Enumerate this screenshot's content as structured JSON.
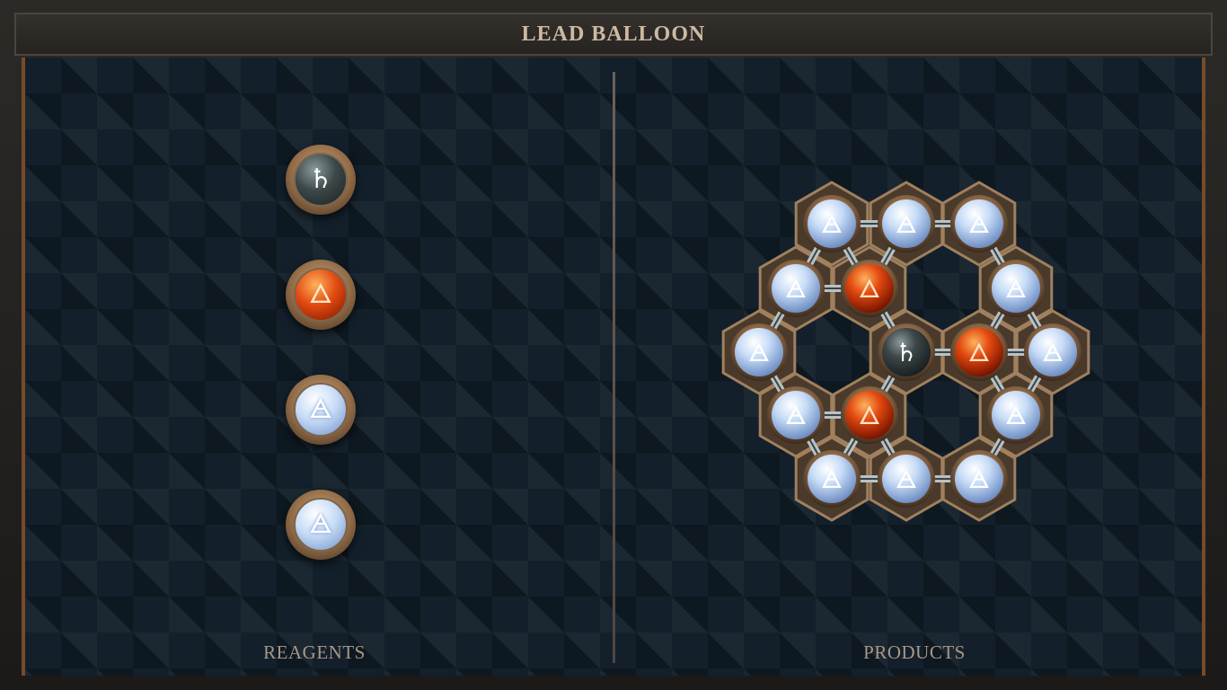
{
  "title": "LEAD BALLOON",
  "panels": {
    "reagents_label": "REAGENTS",
    "products_label": "PRODUCTS"
  },
  "reagents": [
    {
      "element": "lead",
      "symbol": "♄"
    },
    {
      "element": "fire",
      "symbol": "🜂"
    },
    {
      "element": "air",
      "symbol": "🜁"
    },
    {
      "element": "air",
      "symbol": "🜁"
    }
  ],
  "product_molecule": {
    "atoms": [
      {
        "id": "a1",
        "element": "air",
        "symbol": "🜁"
      },
      {
        "id": "a2",
        "element": "air",
        "symbol": "🜁"
      },
      {
        "id": "a3",
        "element": "air",
        "symbol": "🜁"
      },
      {
        "id": "a4",
        "element": "air",
        "symbol": "🜁"
      },
      {
        "id": "f1",
        "element": "fire",
        "symbol": "🜂"
      },
      {
        "id": "a5",
        "element": "air",
        "symbol": "🜁"
      },
      {
        "id": "a6",
        "element": "air",
        "symbol": "🜁"
      },
      {
        "id": "pb",
        "element": "lead",
        "symbol": "♄"
      },
      {
        "id": "f2",
        "element": "fire",
        "symbol": "🜂"
      },
      {
        "id": "a7",
        "element": "air",
        "symbol": "🜁"
      },
      {
        "id": "a8",
        "element": "air",
        "symbol": "🜁"
      },
      {
        "id": "f3",
        "element": "fire",
        "symbol": "🜂"
      },
      {
        "id": "a9",
        "element": "air",
        "symbol": "🜁"
      },
      {
        "id": "a10",
        "element": "air",
        "symbol": "🜁"
      },
      {
        "id": "a11",
        "element": "air",
        "symbol": "🜁"
      },
      {
        "id": "a12",
        "element": "air",
        "symbol": "🜁"
      }
    ]
  },
  "colors": {
    "board_bg": "#13202b",
    "accent_copper": "#7a4a28",
    "title_text": "#cdb9a2",
    "label_text": "#a79788"
  }
}
